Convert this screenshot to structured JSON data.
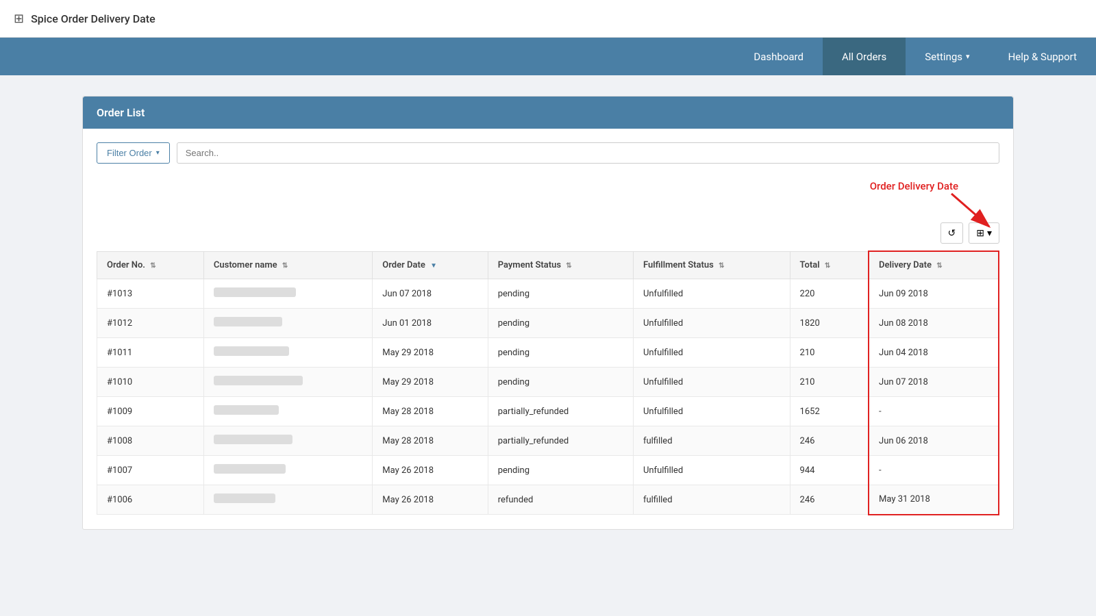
{
  "appTitle": "Spice Order Delivery Date",
  "nav": {
    "items": [
      {
        "id": "dashboard",
        "label": "Dashboard",
        "active": false
      },
      {
        "id": "all-orders",
        "label": "All Orders",
        "active": true
      },
      {
        "id": "settings",
        "label": "Settings",
        "hasDropdown": true,
        "active": false
      },
      {
        "id": "help-support",
        "label": "Help & Support",
        "active": false
      }
    ]
  },
  "orderList": {
    "title": "Order List",
    "filter": {
      "label": "Filter Order"
    },
    "search": {
      "placeholder": "Search.."
    },
    "annotation": "Order Delivery Date",
    "columns": [
      {
        "id": "order-no",
        "label": "Order No.",
        "sortable": true
      },
      {
        "id": "customer-name",
        "label": "Customer name",
        "sortable": true
      },
      {
        "id": "order-date",
        "label": "Order Date",
        "sortable": true,
        "activeSorted": true
      },
      {
        "id": "payment-status",
        "label": "Payment Status",
        "sortable": true
      },
      {
        "id": "fulfillment-status",
        "label": "Fulfillment Status",
        "sortable": true
      },
      {
        "id": "total",
        "label": "Total",
        "sortable": true
      },
      {
        "id": "delivery-date",
        "label": "Delivery Date",
        "sortable": true
      }
    ],
    "rows": [
      {
        "orderNo": "#1013",
        "customerName": "",
        "customerWidth": "120px",
        "orderDate": "Jun 07 2018",
        "paymentStatus": "pending",
        "fulfillmentStatus": "Unfulfilled",
        "total": "220",
        "deliveryDate": "Jun 09 2018"
      },
      {
        "orderNo": "#1012",
        "customerName": "",
        "customerWidth": "100px",
        "orderDate": "Jun 01 2018",
        "paymentStatus": "pending",
        "fulfillmentStatus": "Unfulfilled",
        "total": "1820",
        "deliveryDate": "Jun 08 2018"
      },
      {
        "orderNo": "#1011",
        "customerName": "",
        "customerWidth": "110px",
        "orderDate": "May 29 2018",
        "paymentStatus": "pending",
        "fulfillmentStatus": "Unfulfilled",
        "total": "210",
        "deliveryDate": "Jun 04 2018"
      },
      {
        "orderNo": "#1010",
        "customerName": "",
        "customerWidth": "130px",
        "orderDate": "May 29 2018",
        "paymentStatus": "pending",
        "fulfillmentStatus": "Unfulfilled",
        "total": "210",
        "deliveryDate": "Jun 07 2018"
      },
      {
        "orderNo": "#1009",
        "customerName": "",
        "customerWidth": "95px",
        "orderDate": "May 28 2018",
        "paymentStatus": "partially_refunded",
        "fulfillmentStatus": "Unfulfilled",
        "total": "1652",
        "deliveryDate": "-"
      },
      {
        "orderNo": "#1008",
        "customerName": "",
        "customerWidth": "115px",
        "orderDate": "May 28 2018",
        "paymentStatus": "partially_refunded",
        "fulfillmentStatus": "fulfilled",
        "total": "246",
        "deliveryDate": "Jun 06 2018"
      },
      {
        "orderNo": "#1007",
        "customerName": "",
        "customerWidth": "105px",
        "orderDate": "May 26 2018",
        "paymentStatus": "pending",
        "fulfillmentStatus": "Unfulfilled",
        "total": "944",
        "deliveryDate": "-"
      },
      {
        "orderNo": "#1006",
        "customerName": "",
        "customerWidth": "90px",
        "orderDate": "May 26 2018",
        "paymentStatus": "refunded",
        "fulfillmentStatus": "fulfilled",
        "total": "246",
        "deliveryDate": "May 31 2018"
      }
    ]
  },
  "toolbar": {
    "refreshIcon": "↺",
    "gridIcon": "⊞"
  }
}
